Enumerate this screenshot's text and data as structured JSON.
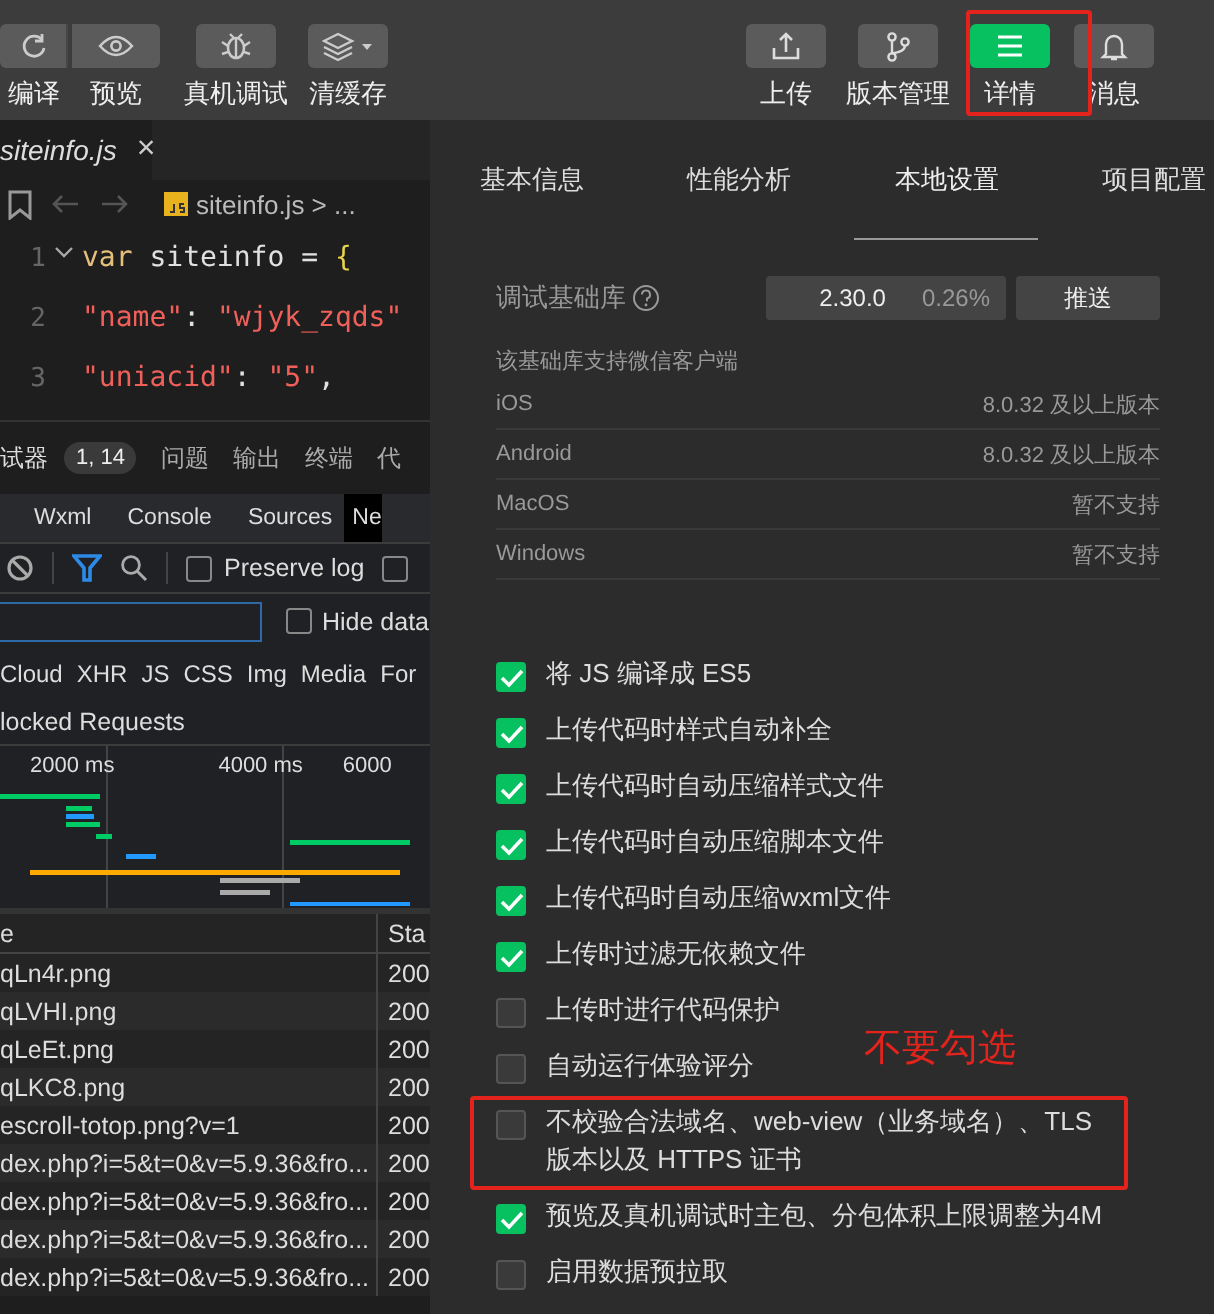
{
  "toolbar": {
    "left": [
      {
        "label": "编译"
      },
      {
        "label": "预览"
      },
      {
        "label": "真机调试"
      },
      {
        "label": "清缓存"
      }
    ],
    "right": [
      {
        "label": "上传",
        "selected": false
      },
      {
        "label": "版本管理",
        "selected": false
      },
      {
        "label": "详情",
        "selected": true
      },
      {
        "label": "消息",
        "selected": false
      }
    ]
  },
  "editor": {
    "tab": "siteinfo.js",
    "close": "×",
    "breadcrumb": "siteinfo.js > ...",
    "lines": [
      {
        "number": "1",
        "tokens": [
          {
            "kind": "keyword",
            "text": "var "
          },
          {
            "kind": "ident",
            "text": "siteinfo = "
          },
          {
            "kind": "brace",
            "text": "{"
          }
        ]
      },
      {
        "number": "2",
        "tokens": [
          {
            "kind": "string",
            "text": "\"name\""
          },
          {
            "kind": "punct",
            "text": ": "
          },
          {
            "kind": "string",
            "text": "\"wjyk_zqds\""
          }
        ]
      },
      {
        "number": "3",
        "tokens": [
          {
            "kind": "string",
            "text": "\"uniacid\""
          },
          {
            "kind": "punct",
            "text": ": "
          },
          {
            "kind": "string",
            "text": "\"5\""
          },
          {
            "kind": "punct",
            "text": ","
          }
        ]
      }
    ]
  },
  "panel_tabs": [
    {
      "label": "试器",
      "selected": true,
      "badge": "1, 14"
    },
    {
      "label": "问题",
      "selected": false
    },
    {
      "label": "输出",
      "selected": false
    },
    {
      "label": "终端",
      "selected": false
    },
    {
      "label": "代",
      "selected": false
    }
  ],
  "devtools_tabs": [
    {
      "label": "Wxml",
      "selected": false
    },
    {
      "label": "Console",
      "selected": false
    },
    {
      "label": "Sources",
      "selected": false
    },
    {
      "label": "Ne",
      "selected": true
    }
  ],
  "network": {
    "preserve_log": {
      "label": "Preserve log",
      "checked": false
    },
    "extra_checkbox": {
      "checked": false
    },
    "hide_data": {
      "label": "Hide data",
      "checked": false
    },
    "types": [
      "Cloud",
      "XHR",
      "JS",
      "CSS",
      "Img",
      "Media",
      "For"
    ],
    "blocked": "locked Requests",
    "ticks": [
      "2000 ms",
      "4000 ms",
      "6000"
    ],
    "columns": [
      "e",
      "Sta"
    ],
    "rows": [
      {
        "name": "qLn4r.png",
        "status": "200"
      },
      {
        "name": "qLVHI.png",
        "status": "200"
      },
      {
        "name": "qLeEt.png",
        "status": "200"
      },
      {
        "name": "qLKC8.png",
        "status": "200"
      },
      {
        "name": "escroll-totop.png?v=1",
        "status": "200"
      },
      {
        "name": "dex.php?i=5&t=0&v=5.9.36&fro...",
        "status": "200"
      },
      {
        "name": "dex.php?i=5&t=0&v=5.9.36&fro...",
        "status": "200"
      },
      {
        "name": "dex.php?i=5&t=0&v=5.9.36&fro...",
        "status": "200"
      },
      {
        "name": "dex.php?i=5&t=0&v=5.9.36&fro...",
        "status": "200"
      }
    ]
  },
  "details": {
    "tabs": [
      {
        "label": "基本信息",
        "selected": false
      },
      {
        "label": "性能分析",
        "selected": false
      },
      {
        "label": "本地设置",
        "selected": true
      },
      {
        "label": "项目配置",
        "selected": false
      }
    ],
    "library": {
      "label": "调试基础库",
      "version": "2.30.0",
      "share": "0.26%",
      "push": "推送"
    },
    "support_title": "该基础库支持微信客户端",
    "support": [
      {
        "platform": "iOS",
        "value": "8.0.32 及以上版本"
      },
      {
        "platform": "Android",
        "value": "8.0.32 及以上版本"
      },
      {
        "platform": "MacOS",
        "value": "暂不支持"
      },
      {
        "platform": "Windows",
        "value": "暂不支持"
      }
    ],
    "options": [
      {
        "label": "将 JS 编译成 ES5",
        "checked": true
      },
      {
        "label": "上传代码时样式自动补全",
        "checked": true
      },
      {
        "label": "上传代码时自动压缩样式文件",
        "checked": true
      },
      {
        "label": "上传代码时自动压缩脚本文件",
        "checked": true
      },
      {
        "label": "上传代码时自动压缩wxml文件",
        "checked": true
      },
      {
        "label": "上传时过滤无依赖文件",
        "checked": true
      },
      {
        "label": "上传时进行代码保护",
        "checked": false
      },
      {
        "label": "自动运行体验评分",
        "checked": false
      },
      {
        "label": "不校验合法域名、web-view（业务域名）、TLS 版本以及 HTTPS 证书",
        "checked": false,
        "highlighted": true
      },
      {
        "label": "预览及真机调试时主包、分包体积上限调整为4M",
        "checked": true
      },
      {
        "label": "启用数据预拉取",
        "checked": false
      }
    ]
  },
  "annotation": {
    "text": "不要勾选"
  }
}
